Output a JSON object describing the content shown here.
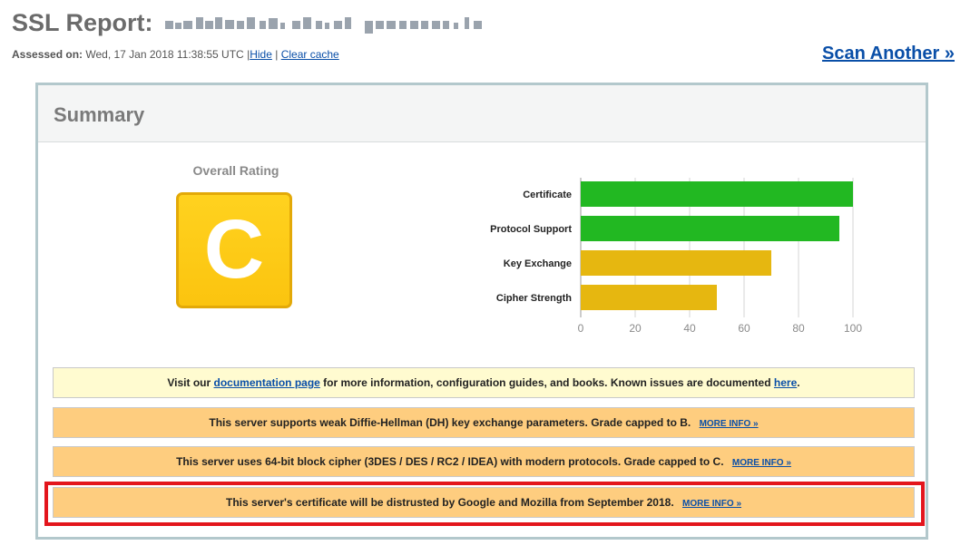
{
  "header": {
    "title": "SSL Report:",
    "assessed_label": "Assessed on:",
    "assessed_value": "Wed, 17 Jan 2018 11:38:55 UTC",
    "separator": "|",
    "hide_link": "Hide",
    "clear_cache_link": "Clear cache",
    "scan_another": "Scan Another »"
  },
  "summary": {
    "title": "Summary",
    "overall_rating_label": "Overall Rating",
    "grade": "C",
    "grade_color": "#fbc40f"
  },
  "chart_data": {
    "type": "bar",
    "orientation": "horizontal",
    "categories": [
      "Certificate",
      "Protocol Support",
      "Key Exchange",
      "Cipher Strength"
    ],
    "values": [
      100,
      95,
      70,
      50
    ],
    "colors": [
      "#22b822",
      "#22b822",
      "#e6b710",
      "#e6b710"
    ],
    "xlim": [
      0,
      100
    ],
    "xticks": [
      "0",
      "20",
      "40",
      "60",
      "80",
      "100"
    ],
    "grid": true
  },
  "notices": {
    "doc": {
      "pre": "Visit our ",
      "link1": "documentation page",
      "mid": " for more information, configuration guides, and books. Known issues are documented ",
      "link2": "here",
      "post": "."
    },
    "dh": {
      "text": "This server supports weak Diffie-Hellman (DH) key exchange parameters. Grade capped to B.",
      "more": "MORE INFO »"
    },
    "cipher64": {
      "text": "This server uses 64-bit block cipher (3DES / DES / RC2 / IDEA) with modern protocols. Grade capped to C.",
      "more": "MORE INFO »"
    },
    "distrust": {
      "text": "This server's certificate will be distrusted by Google and Mozilla from September 2018.",
      "more": "MORE INFO »"
    }
  }
}
